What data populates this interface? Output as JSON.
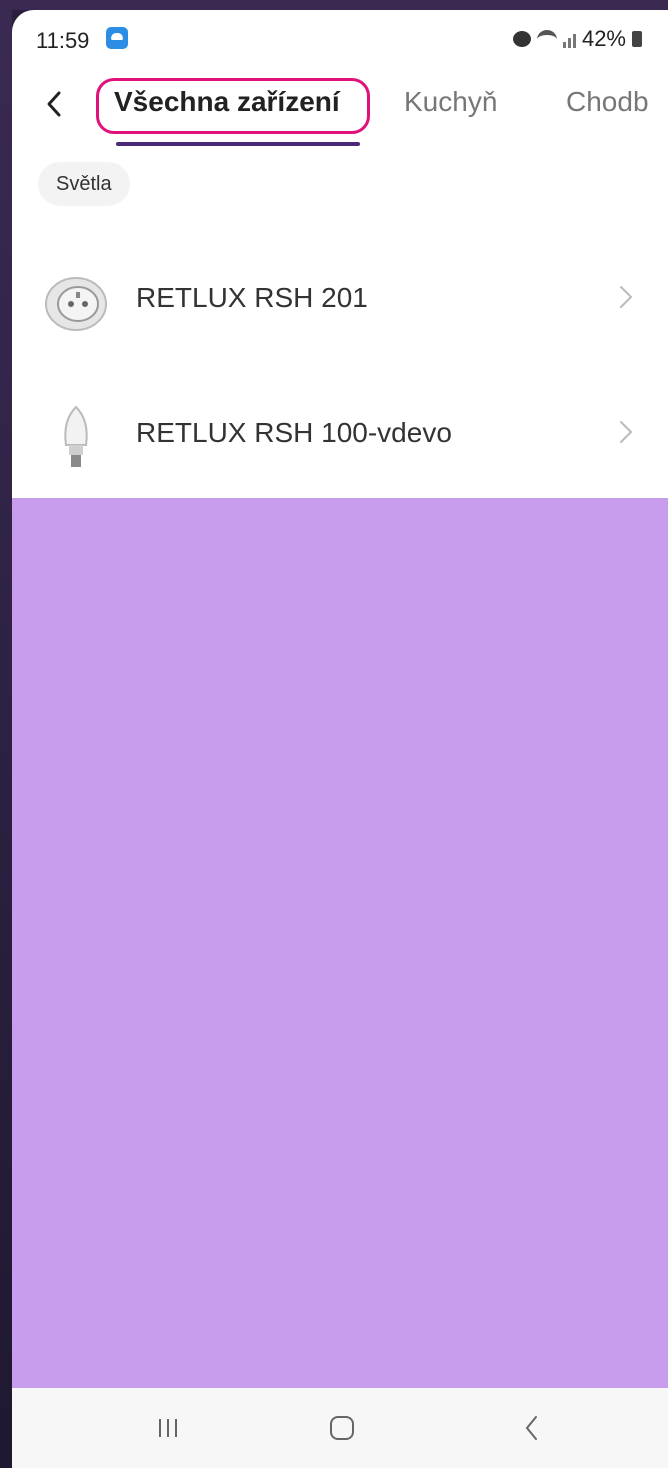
{
  "status_bar": {
    "time": "11:59",
    "battery": "42%",
    "icons": [
      "app-notification-icon",
      "alarm-icon",
      "wifi-icon",
      "signal-icon",
      "battery-icon"
    ]
  },
  "header": {
    "back_icon": "chevron-left-icon",
    "tabs": [
      {
        "label": "Všechna zařízení",
        "active": true
      },
      {
        "label": "Kuchyň",
        "active": false
      },
      {
        "label": "Chodb",
        "active": false
      }
    ],
    "highlight_color": "#e0117a",
    "underline_color": "#4a2a78"
  },
  "filter": {
    "chip_label": "Světla"
  },
  "devices": [
    {
      "name": "RETLUX RSH 201",
      "icon": "smart-plug-icon"
    },
    {
      "name": "RETLUX RSH 100-vdevo",
      "icon": "light-bulb-icon"
    }
  ],
  "overlay_color": "#c99dee",
  "navigation": {
    "buttons": [
      "recents-icon",
      "home-icon",
      "back-icon"
    ]
  }
}
